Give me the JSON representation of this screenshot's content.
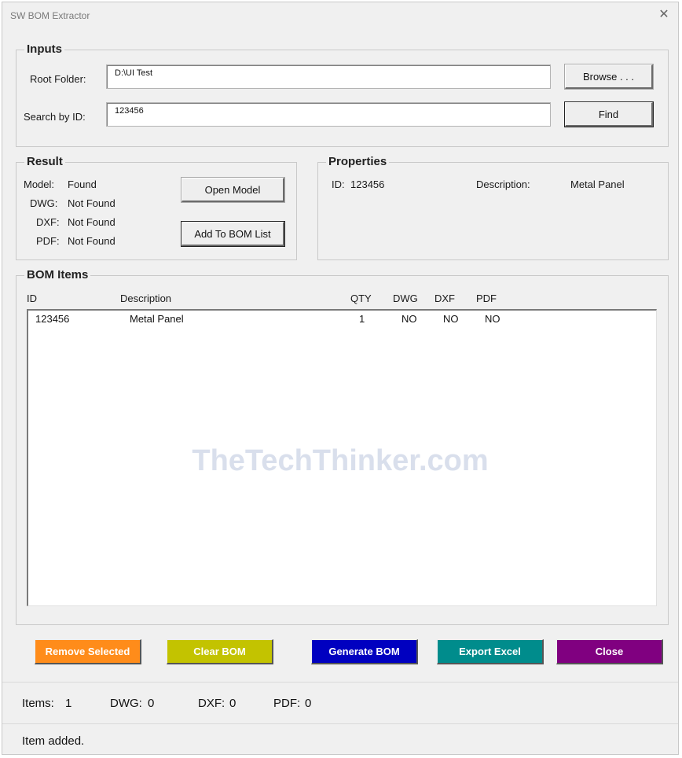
{
  "window": {
    "title": "SW BOM Extractor"
  },
  "inputs": {
    "legend": "Inputs",
    "root_folder_label": "Root Folder:",
    "root_folder_value": "D:\\UI Test",
    "browse_label": "Browse . . .",
    "search_label": "Search by ID:",
    "search_value": "123456",
    "find_label": "Find"
  },
  "result": {
    "legend": "Result",
    "rows": [
      {
        "label": "Model:",
        "value": "Found"
      },
      {
        "label": "DWG:",
        "value": "Not Found"
      },
      {
        "label": "DXF:",
        "value": "Not Found"
      },
      {
        "label": "PDF:",
        "value": "Not Found"
      }
    ],
    "open_model_label": "Open Model",
    "add_to_bom_label": "Add To BOM List"
  },
  "properties": {
    "legend": "Properties",
    "id_label": "ID:",
    "id_value": "123456",
    "desc_label": "Description:",
    "desc_value": "Metal Panel"
  },
  "bom": {
    "legend": "BOM Items",
    "columns": [
      "ID",
      "Description",
      "QTY",
      "DWG",
      "DXF",
      "PDF"
    ],
    "rows": [
      {
        "id": "123456",
        "description": "Metal Panel",
        "qty": "1",
        "dwg": "NO",
        "dxf": "NO",
        "pdf": "NO"
      }
    ]
  },
  "watermark": "TheTechThinker.com",
  "actions": [
    {
      "label": "Remove Selected",
      "bg": "#ff8c1a",
      "fg": "#ffffff"
    },
    {
      "label": "Clear BOM",
      "bg": "#c3c300",
      "fg": "#ffffff"
    },
    {
      "label": "Generate BOM",
      "bg": "#0000c0",
      "fg": "#ffffff"
    },
    {
      "label": "Export Excel",
      "bg": "#008c8c",
      "fg": "#ffffff"
    },
    {
      "label": "Close",
      "bg": "#800080",
      "fg": "#ffffff"
    }
  ],
  "counts": {
    "items_label": "Items:",
    "items_value": "1",
    "dwg_label": "DWG:",
    "dwg_value": "0",
    "dxf_label": "DXF:",
    "dxf_value": "0",
    "pdf_label": "PDF:",
    "pdf_value": "0"
  },
  "status_message": "Item added."
}
